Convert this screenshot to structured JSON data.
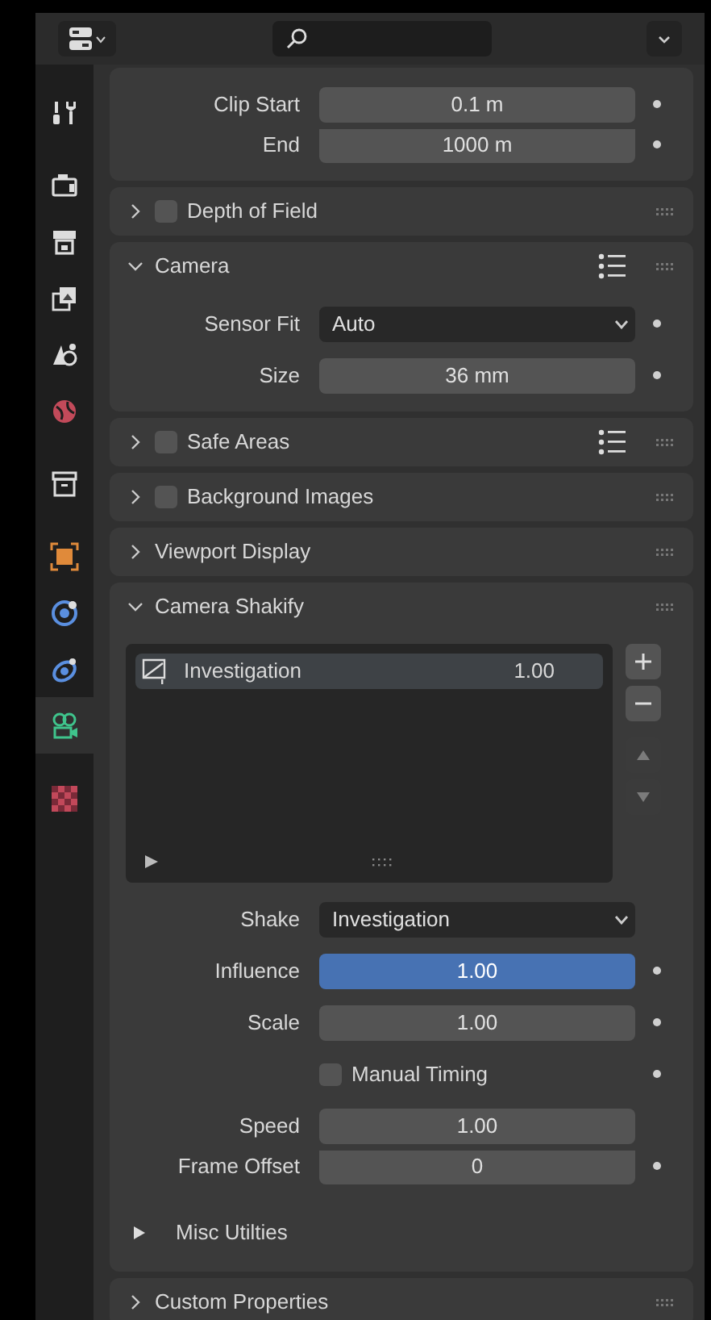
{
  "sidebar": {
    "groups": [
      [
        {
          "kind": "tool",
          "selected": false
        }
      ],
      [
        {
          "kind": "render",
          "selected": false
        },
        {
          "kind": "output",
          "selected": false
        },
        {
          "kind": "view_layer",
          "selected": false
        },
        {
          "kind": "scene",
          "selected": false
        },
        {
          "kind": "world",
          "selected": false
        }
      ],
      [
        {
          "kind": "collection",
          "selected": false
        }
      ],
      [
        {
          "kind": "object",
          "selected": false
        },
        {
          "kind": "physics",
          "selected": false
        },
        {
          "kind": "constraint",
          "selected": false
        },
        {
          "kind": "camera_data",
          "selected": true
        }
      ],
      [
        {
          "kind": "texture",
          "selected": false
        }
      ]
    ]
  },
  "panels": [
    {
      "expanded": true,
      "rows": [
        {
          "kind": "number",
          "label": "Clip Start",
          "value": "0.1 m",
          "animatable": true,
          "active": false
        },
        {
          "kind": "number",
          "label": "End",
          "value": "1000 m",
          "animatable": true,
          "active": false,
          "aligned": true
        }
      ]
    },
    {
      "title": "Depth of Field",
      "expanded": false,
      "checked": false
    },
    {
      "title": "Camera",
      "expanded": true,
      "presets": true,
      "rows": [
        {
          "kind": "dropdown",
          "label": "Sensor Fit",
          "value": "Auto",
          "animatable": true
        },
        {
          "kind": "number",
          "label": "Size",
          "value": "36 mm",
          "animatable": true,
          "active": false
        }
      ]
    },
    {
      "title": "Safe Areas",
      "expanded": false,
      "checked": false,
      "presets": true
    },
    {
      "title": "Background Images",
      "expanded": false,
      "checked": false
    },
    {
      "title": "Viewport Display",
      "expanded": false
    },
    {
      "title": "Camera Shakify",
      "expanded": true,
      "rows": [
        {
          "kind": "list",
          "items": [
            {
              "name": "Investigation",
              "value": "1.00",
              "selected": true
            }
          ],
          "controls": [
            {
              "kind": "add",
              "disabled": false
            },
            {
              "kind": "remove",
              "disabled": false
            },
            {
              "kind": "up",
              "disabled": true
            },
            {
              "kind": "down",
              "disabled": true
            }
          ]
        },
        {
          "kind": "dropdown",
          "label": "Shake",
          "value": "Investigation",
          "animatable": false
        },
        {
          "kind": "number",
          "label": "Influence",
          "value": "1.00",
          "animatable": true,
          "active": true
        },
        {
          "kind": "number",
          "label": "Scale",
          "value": "1.00",
          "animatable": true,
          "active": false
        },
        {
          "kind": "checkbox",
          "label": "Manual Timing",
          "checked": false,
          "animatable": true
        },
        {
          "kind": "number",
          "label": "Speed",
          "value": "1.00",
          "animatable": false,
          "active": false
        },
        {
          "kind": "number",
          "label": "Frame Offset",
          "value": "0",
          "animatable": true,
          "active": false,
          "aligned": true
        },
        {
          "kind": "subpanel",
          "label": "Misc Utilties",
          "expanded": false
        }
      ]
    },
    {
      "title": "Custom Properties",
      "expanded": false
    }
  ]
}
